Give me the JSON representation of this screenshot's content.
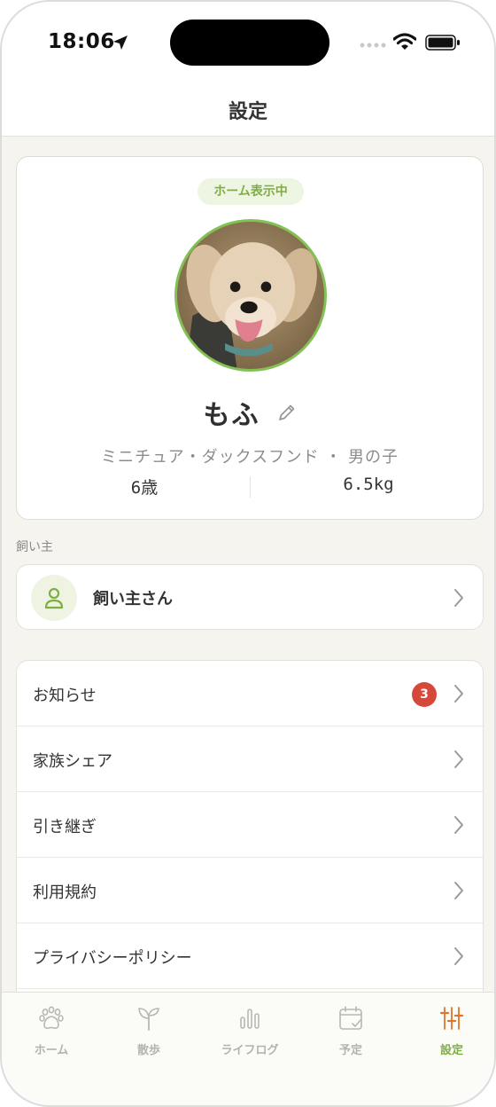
{
  "status_bar": {
    "time": "18:06"
  },
  "nav": {
    "title": "設定"
  },
  "pet": {
    "home_badge": "ホーム表示中",
    "name": "もふ",
    "breed_gender": "ミニチュア・ダックスフンド ・ 男の子",
    "age": "6歳",
    "weight": "6.5kg"
  },
  "owner_section": {
    "label": "飼い主",
    "name": "飼い主さん"
  },
  "menu": {
    "items": [
      {
        "label": "お知らせ",
        "badge": "3"
      },
      {
        "label": "家族シェア"
      },
      {
        "label": "引き継ぎ"
      },
      {
        "label": "利用規約"
      },
      {
        "label": "プライバシーポリシー"
      }
    ]
  },
  "tabs": [
    {
      "label": "ホーム",
      "icon": "paw-icon",
      "active": false
    },
    {
      "label": "散歩",
      "icon": "sprout-icon",
      "active": false
    },
    {
      "label": "ライフログ",
      "icon": "bar-chart-icon",
      "active": false
    },
    {
      "label": "予定",
      "icon": "calendar-check-icon",
      "active": false
    },
    {
      "label": "設定",
      "icon": "sliders-icon",
      "active": true
    }
  ],
  "colors": {
    "accent": "#7fae45",
    "badge": "#d6493a",
    "background": "#f5f4ee"
  }
}
